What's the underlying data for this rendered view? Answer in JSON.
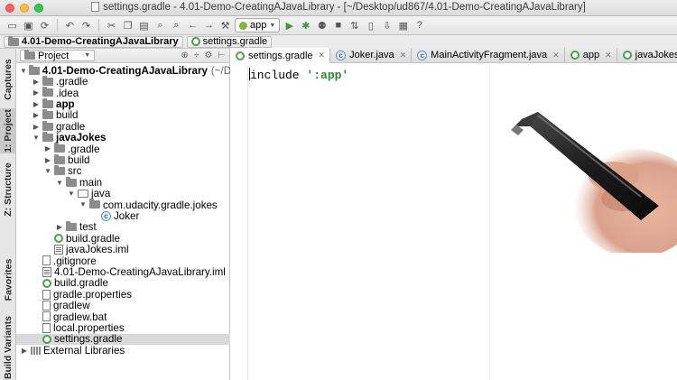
{
  "window": {
    "title": "settings.gradle - 4.01-Demo-CreatingAJavaLibrary - [~/Desktop/ud867/4.01-Demo-CreatingAJavaLibrary]"
  },
  "toolbar": {
    "run_config": "app"
  },
  "breadcrumb": {
    "project": "4.01-Demo-CreatingAJavaLibrary",
    "file": "settings.gradle"
  },
  "tool_strip": {
    "captures": "Captures",
    "project": "1: Project",
    "structure": "Z: Structure",
    "favorites": "Favorites",
    "build_variants": "Build Variants"
  },
  "project_panel": {
    "view": "Project",
    "tree": [
      {
        "label": "4.01-Demo-CreatingAJavaLibrary",
        "suffix": "(~/De",
        "depth": 0,
        "arrow": "open",
        "icon": "folder",
        "bold": true
      },
      {
        "label": ".gradle",
        "depth": 1,
        "arrow": "closed",
        "icon": "folder"
      },
      {
        "label": ".idea",
        "depth": 1,
        "arrow": "closed",
        "icon": "folder"
      },
      {
        "label": "app",
        "depth": 1,
        "arrow": "closed",
        "icon": "folder",
        "bold": true
      },
      {
        "label": "build",
        "depth": 1,
        "arrow": "closed",
        "icon": "folder"
      },
      {
        "label": "gradle",
        "depth": 1,
        "arrow": "closed",
        "icon": "folder"
      },
      {
        "label": "javaJokes",
        "depth": 1,
        "arrow": "open",
        "icon": "folder",
        "bold": true
      },
      {
        "label": ".gradle",
        "depth": 2,
        "arrow": "closed",
        "icon": "folder"
      },
      {
        "label": "build",
        "depth": 2,
        "arrow": "closed",
        "icon": "folder"
      },
      {
        "label": "src",
        "depth": 2,
        "arrow": "open",
        "icon": "folder"
      },
      {
        "label": "main",
        "depth": 3,
        "arrow": "open",
        "icon": "folder"
      },
      {
        "label": "java",
        "depth": 4,
        "arrow": "open",
        "icon": "folder-outline"
      },
      {
        "label": "com.udacity.gradle.jokes",
        "depth": 5,
        "arrow": "open",
        "icon": "folder"
      },
      {
        "label": "Joker",
        "depth": 6,
        "arrow": "none",
        "icon": "class"
      },
      {
        "label": "test",
        "depth": 3,
        "arrow": "closed",
        "icon": "folder"
      },
      {
        "label": "build.gradle",
        "depth": 2,
        "arrow": "none",
        "icon": "gradle"
      },
      {
        "label": "javaJokes.iml",
        "depth": 2,
        "arrow": "none",
        "icon": "iml"
      },
      {
        "label": ".gitignore",
        "depth": 1,
        "arrow": "none",
        "icon": "file"
      },
      {
        "label": "4.01-Demo-CreatingAJavaLibrary.iml",
        "depth": 1,
        "arrow": "none",
        "icon": "iml"
      },
      {
        "label": "build.gradle",
        "depth": 1,
        "arrow": "none",
        "icon": "gradle"
      },
      {
        "label": "gradle.properties",
        "depth": 1,
        "arrow": "none",
        "icon": "file"
      },
      {
        "label": "gradlew",
        "depth": 1,
        "arrow": "none",
        "icon": "file"
      },
      {
        "label": "gradlew.bat",
        "depth": 1,
        "arrow": "none",
        "icon": "file"
      },
      {
        "label": "local.properties",
        "depth": 1,
        "arrow": "none",
        "icon": "file"
      },
      {
        "label": "settings.gradle",
        "depth": 1,
        "arrow": "none",
        "icon": "gradle",
        "selected": true
      },
      {
        "label": "External Libraries",
        "depth": 0,
        "arrow": "closed",
        "icon": "library"
      }
    ]
  },
  "editor": {
    "tabs": [
      {
        "label": "settings.gradle",
        "icon": "gradle",
        "active": true
      },
      {
        "label": "Joker.java",
        "icon": "class"
      },
      {
        "label": "MainActivityFragment.java",
        "icon": "class"
      },
      {
        "label": "app",
        "icon": "gradle"
      },
      {
        "label": "javaJokes",
        "icon": "gradle"
      }
    ],
    "code": {
      "keyword": "include",
      "string": "':app'"
    }
  },
  "colors": {
    "string": "#2a8a2a",
    "selection": "#d9d9d9",
    "gradle_icon": "#4ba04b"
  }
}
